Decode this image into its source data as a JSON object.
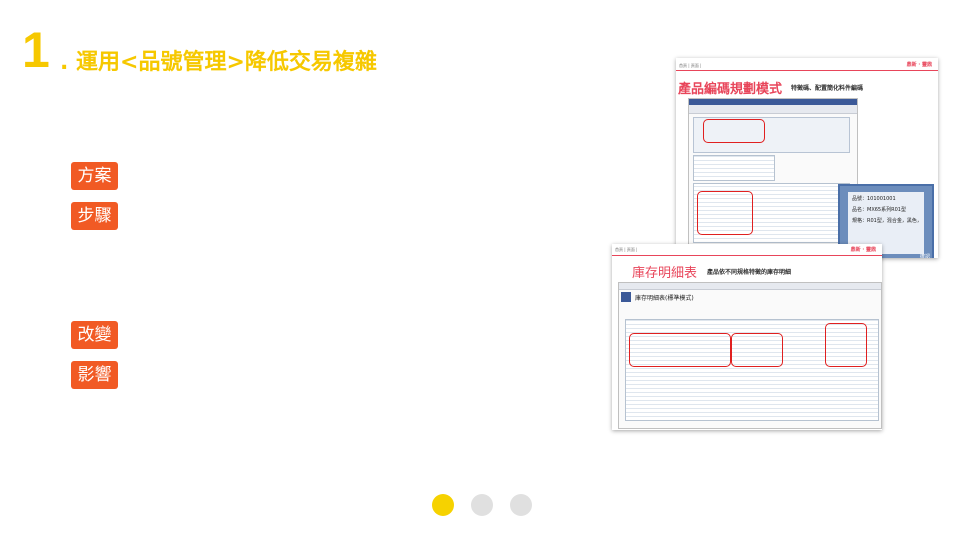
{
  "title": {
    "number": "1",
    "text": ". 運用<品號管理>降低交易複雜"
  },
  "tags": [
    "方案",
    "步驟",
    "改變",
    "影響"
  ],
  "screenshot1": {
    "crumb": "首頁 | 頁面 | ",
    "brand": "鼎新 · 靈鼎",
    "heading": "產品編碼規劃模式",
    "subheading": "特徵碼、配置簡化料件編碼",
    "callout_lines": [
      "品號：101001001",
      "品名：MX65系列R01型",
      "規格：R01型，混合金，黑色，15X塗"
    ],
    "callout_footer": "確認"
  },
  "screenshot2": {
    "crumb": "首頁 | 頁面 | ",
    "brand": "鼎新 · 靈鼎",
    "heading": "庫存明細表",
    "subheading": "產品依不同規格特徵的庫存明細",
    "window_title": "庫存明細表(標準模式)"
  },
  "pager": {
    "active_color": "#f6d200",
    "inactive_color": "#e0e0e0"
  }
}
